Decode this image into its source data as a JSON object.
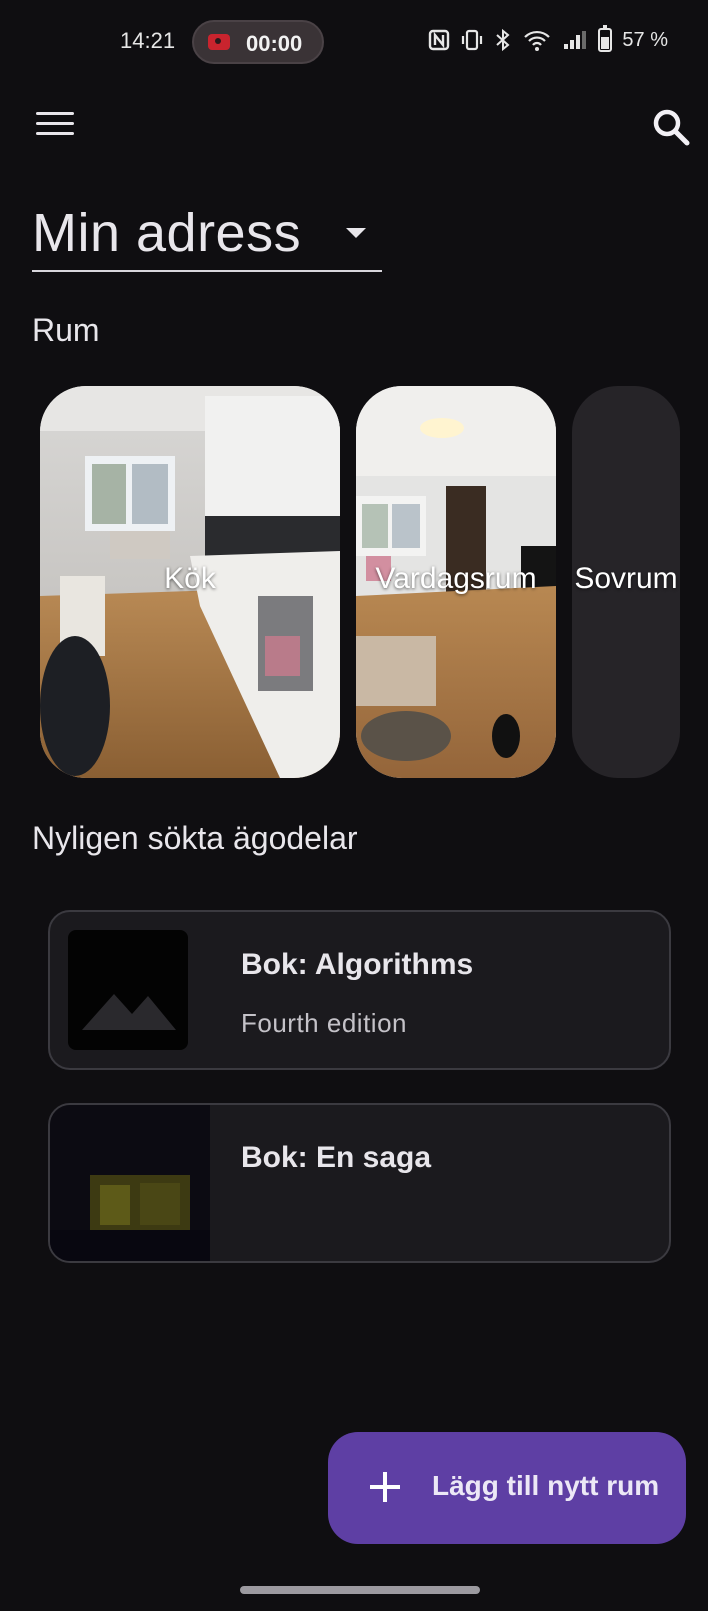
{
  "status_bar": {
    "time": "14:21",
    "recording_time": "00:00",
    "battery": "57 %",
    "icons": [
      "nfc-icon",
      "vibrate-icon",
      "bluetooth-icon",
      "wifi-icon",
      "signal-icon",
      "battery-icon"
    ]
  },
  "app_bar": {
    "menu_icon": "menu-icon",
    "search_icon": "search-icon"
  },
  "address_selector": {
    "value": "Min adress"
  },
  "rooms": {
    "heading": "Rum",
    "items": [
      {
        "label": "Kök"
      },
      {
        "label": "Vardagsrum"
      },
      {
        "label": "Sovrum"
      }
    ]
  },
  "recent": {
    "heading": "Nyligen sökta ägodelar",
    "items": [
      {
        "title": "Bok: Algorithms",
        "subtitle": "Fourth edition",
        "thumb": "image-placeholder-icon"
      },
      {
        "title": "Bok: En saga",
        "subtitle": "",
        "thumb": "photo"
      }
    ]
  },
  "fab": {
    "label": "Lägg till nytt rum",
    "icon": "plus-icon"
  },
  "colors": {
    "background": "#0f0e11",
    "card": "#1b1a1e",
    "accent": "#5e3fa4"
  }
}
